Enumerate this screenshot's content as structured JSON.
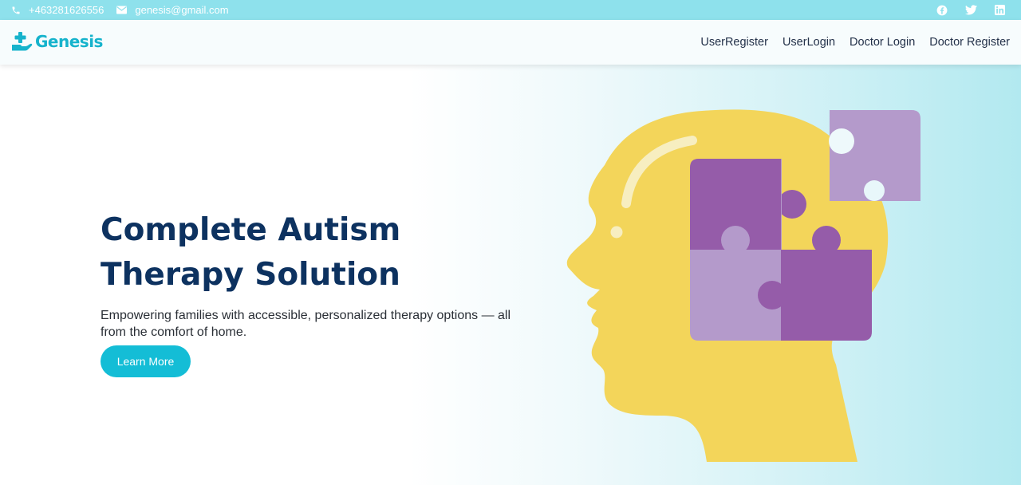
{
  "topbar": {
    "phone": "+463281626556",
    "email": "genesis@gmail.com",
    "social_icons": [
      "facebook-icon",
      "twitter-icon",
      "linkedin-icon"
    ]
  },
  "brand": {
    "name": "Genesis",
    "logo_icon": "plus-hand-icon"
  },
  "nav": {
    "items": [
      {
        "label": "UserRegister"
      },
      {
        "label": "UserLogin"
      },
      {
        "label": "Doctor Login"
      },
      {
        "label": "Doctor Register"
      }
    ]
  },
  "hero": {
    "title_line1": "Complete Autism",
    "title_line2": "Therapy Solution",
    "subtitle": "Empowering families with accessible, personalized therapy options — all from the comfort of home.",
    "button_label": "Learn More",
    "illustration": "head-with-puzzle-pieces"
  },
  "colors": {
    "topbar": "#8ee1ec",
    "brand": "#16b3cc",
    "title": "#0d3260",
    "button": "#14bdd6",
    "head": "#f3d55a",
    "puzzle_dark": "#955ca9",
    "puzzle_light": "#b49acb"
  }
}
